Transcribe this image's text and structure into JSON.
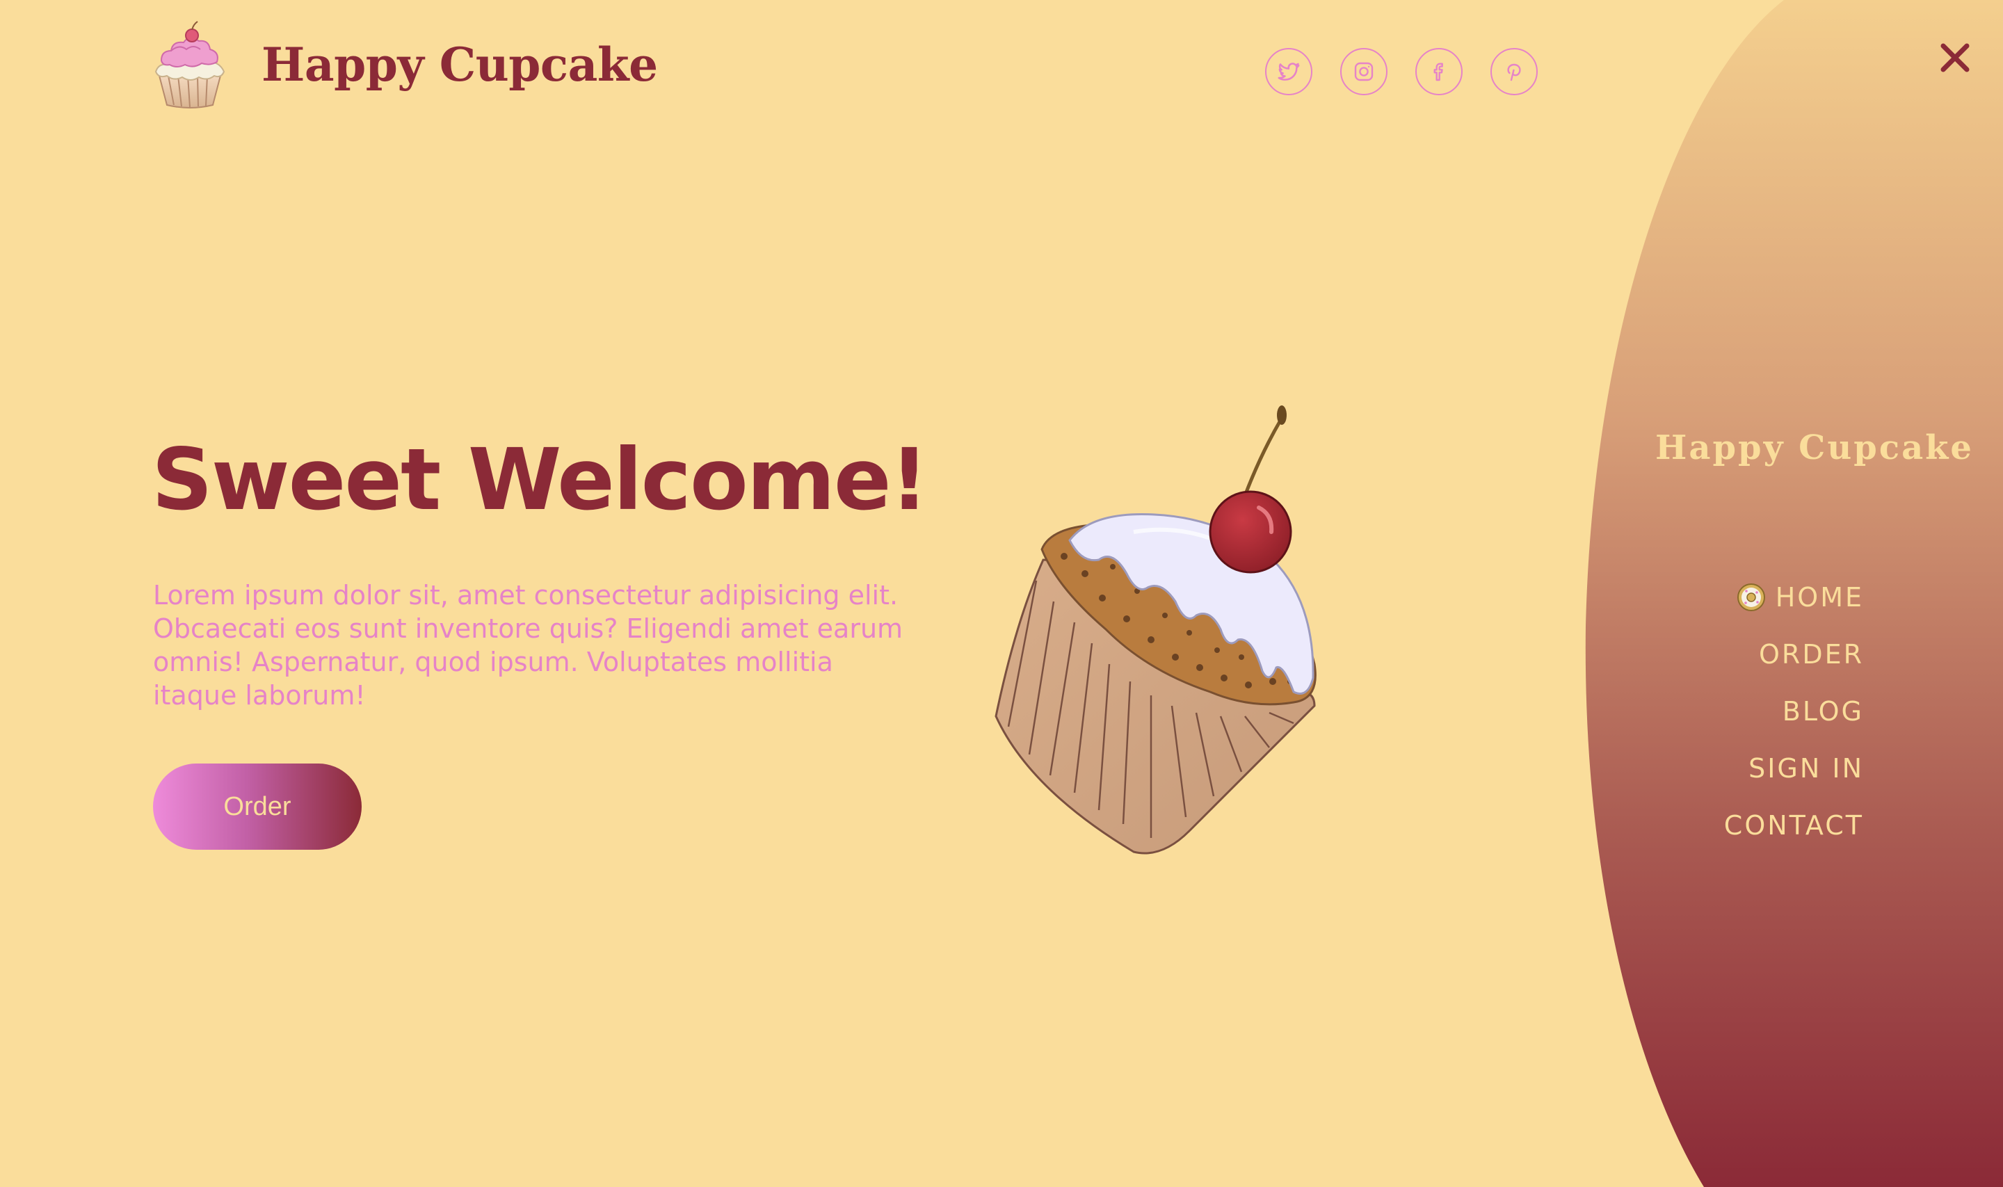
{
  "header": {
    "brand_name": "Happy Cupcake",
    "socials": [
      {
        "name": "twitter",
        "icon": "twitter-icon"
      },
      {
        "name": "instagram",
        "icon": "instagram-icon"
      },
      {
        "name": "facebook",
        "icon": "facebook-icon"
      },
      {
        "name": "pinterest",
        "icon": "pinterest-icon"
      }
    ]
  },
  "hero": {
    "title": "Sweet Welcome!",
    "text": "Lorem ipsum dolor sit, amet consectetur adipisicing elit. Obcaecati eos sunt inventore quis? Eligendi amet earum omnis! Aspernatur, quod ipsum. Voluptates mollitia itaque laborum!",
    "order_label": "Order",
    "illustration": "cupcake-with-cherry-illustration"
  },
  "menu": {
    "brand_name": "Happy Cupcake",
    "close_icon": "close-icon",
    "items": [
      {
        "label": "HOME",
        "active": true,
        "active_icon": "donut-icon"
      },
      {
        "label": "ORDER"
      },
      {
        "label": "BLOG"
      },
      {
        "label": "SIGN IN"
      },
      {
        "label": "CONTACT"
      }
    ]
  },
  "colors": {
    "background": "#fadd9b",
    "primary": "#8b2a37",
    "accent_pink": "#e683c8",
    "menu_gradient_top": "#f4cf8e",
    "menu_gradient_bottom": "#8b2a37"
  }
}
